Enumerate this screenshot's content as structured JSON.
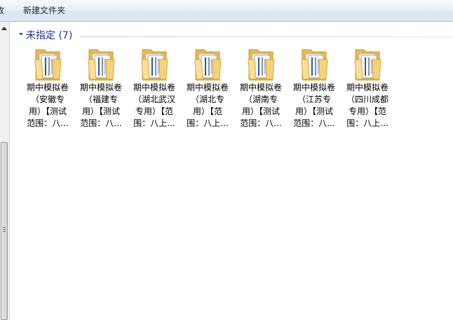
{
  "toolbar": {
    "cut_label": "收",
    "new_folder_label": "新建文件夹"
  },
  "group": {
    "title": "未指定 (7)"
  },
  "folders": [
    {
      "name": "期中模拟卷\n（安徽专\n用）【测试\n范围：八..."
    },
    {
      "name": "期中模拟卷\n（福建专\n用）【测试\n范围：八..."
    },
    {
      "name": "期中模拟卷\n（湖北武汉\n专用）【范\n围：八上..."
    },
    {
      "name": "期中模拟卷\n（湖北专\n用）【范\n围：八上..."
    },
    {
      "name": "期中模拟卷\n（湖南专\n用）【测试\n范围：八..."
    },
    {
      "name": "期中模拟卷\n（江苏专\n用）【测试\n范围：八..."
    },
    {
      "name": "期中模拟卷\n（四川成都\n专用）【范\n围：八上..."
    }
  ],
  "icons": {
    "folder": "folder-icon",
    "collapse": "chevron-down-icon",
    "scroll_up": "scroll-up-arrow-icon"
  },
  "colors": {
    "group_title": "#1e3287",
    "folder_body": "#f4d27c",
    "folder_back": "#e6b94e"
  }
}
